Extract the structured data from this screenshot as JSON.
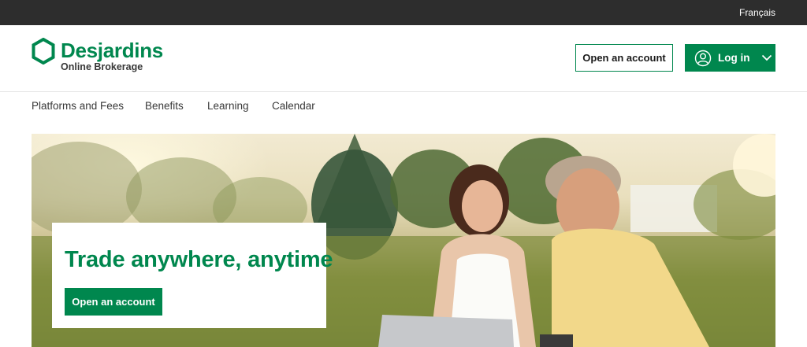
{
  "topbar": {
    "language_link": "Français"
  },
  "brand": {
    "name": "Desjardins",
    "subtitle": "Online Brokerage",
    "color": "#00874e"
  },
  "header": {
    "open_account_label": "Open an account",
    "login_label": "Log in"
  },
  "nav": {
    "items": [
      {
        "label": "Platforms and Fees"
      },
      {
        "label": "Benefits"
      },
      {
        "label": "Learning"
      },
      {
        "label": "Calendar"
      }
    ]
  },
  "hero": {
    "title": "Trade anywhere, anytime",
    "cta_label": "Open an account"
  },
  "icons": {
    "logo": "desjardins-hexagon-icon",
    "login": "user-circle-icon",
    "login_dropdown": "chevron-down-icon"
  }
}
